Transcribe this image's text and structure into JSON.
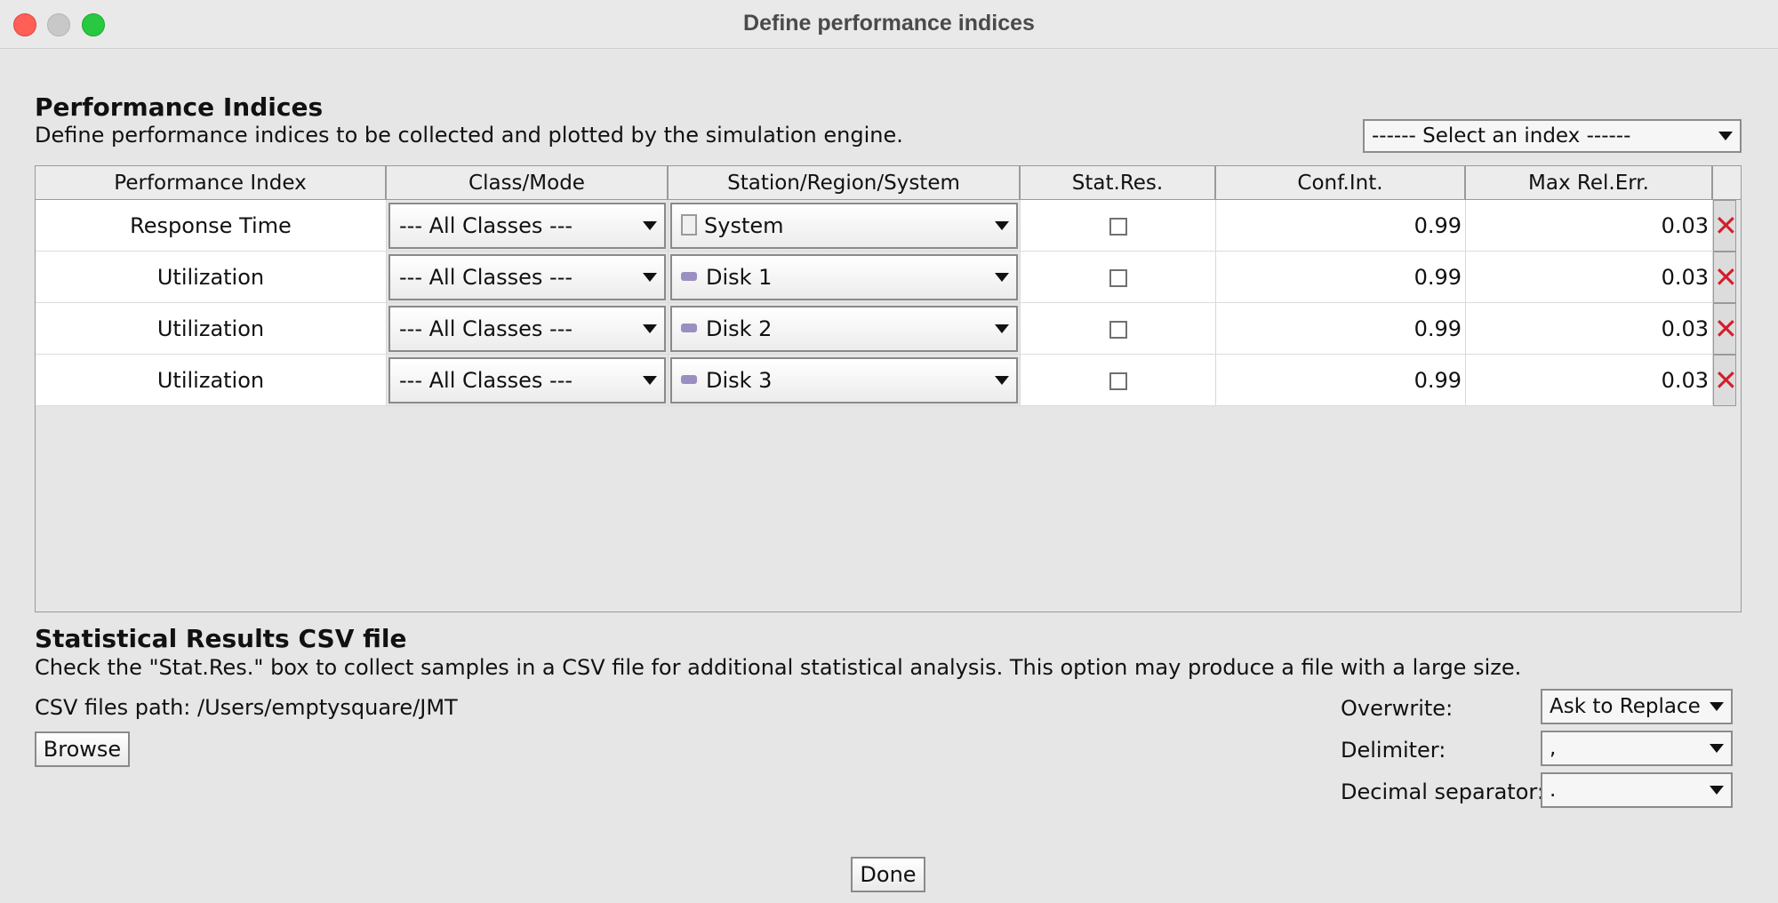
{
  "window": {
    "title": "Define performance indices"
  },
  "header": {
    "title": "Performance Indices",
    "description": "Define performance indices to be collected and plotted by the simulation engine.",
    "select_index": "------ Select an index  ------"
  },
  "table": {
    "columns": [
      "Performance Index",
      "Class/Mode",
      "Station/Region/System",
      "Stat.Res.",
      "Conf.Int.",
      "Max Rel.Err."
    ],
    "rows": [
      {
        "index": "Response Time",
        "class": "--- All Classes ---",
        "station": "System",
        "station_icon": "system-icon",
        "stat_res": false,
        "conf_int": "0.99",
        "max_rel_err": "0.03"
      },
      {
        "index": "Utilization",
        "class": "--- All Classes ---",
        "station": "Disk 1",
        "station_icon": "station-icon",
        "stat_res": false,
        "conf_int": "0.99",
        "max_rel_err": "0.03"
      },
      {
        "index": "Utilization",
        "class": "--- All Classes ---",
        "station": "Disk 2",
        "station_icon": "station-icon",
        "stat_res": false,
        "conf_int": "0.99",
        "max_rel_err": "0.03"
      },
      {
        "index": "Utilization",
        "class": "--- All Classes ---",
        "station": "Disk 3",
        "station_icon": "station-icon",
        "stat_res": false,
        "conf_int": "0.99",
        "max_rel_err": "0.03"
      }
    ],
    "delete_icon": "delete-x-icon",
    "delete_color": "#d21e2b"
  },
  "csv": {
    "title": "Statistical Results CSV file",
    "description": "Check the \"Stat.Res.\" box to collect samples in a CSV file for additional statistical analysis. This option may produce a file with a large size.",
    "path_label": "CSV files path:",
    "path_value": "/Users/emptysquare/JMT",
    "browse_label": "Browse",
    "overwrite_label": "Overwrite:",
    "overwrite_value": "Ask to Replace",
    "delimiter_label": "Delimiter:",
    "delimiter_value": ",",
    "decimal_label": "Decimal separator:",
    "decimal_value": "."
  },
  "footer": {
    "done_label": "Done"
  }
}
